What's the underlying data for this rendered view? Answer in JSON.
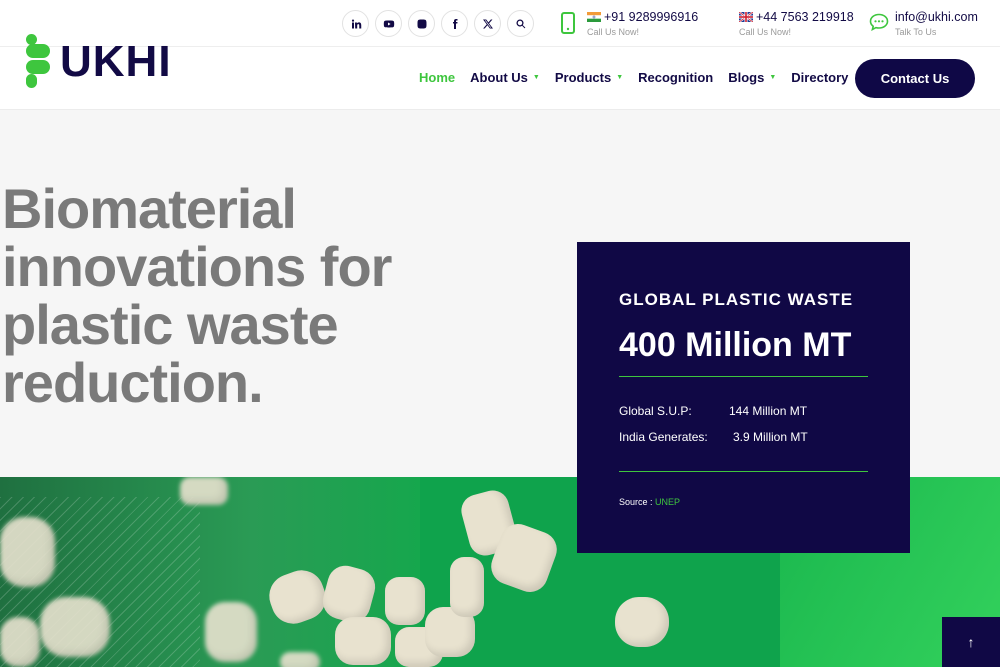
{
  "brand": {
    "name": "UKHI"
  },
  "social_icons": [
    "linkedin-icon",
    "youtube-icon",
    "instagram-icon",
    "facebook-icon",
    "x-twitter-icon",
    "search-icon"
  ],
  "contacts": {
    "india_phone": {
      "number": "+91 9289996916",
      "sub": "Call Us Now!"
    },
    "uk_phone": {
      "number": "+44 7563 219918",
      "sub": "Call Us Now!"
    },
    "email": {
      "address": "info@ukhi.com",
      "sub": "Talk To Us"
    }
  },
  "nav": {
    "items": [
      {
        "label": "Home",
        "active": true,
        "has_dropdown": false
      },
      {
        "label": "About Us",
        "active": false,
        "has_dropdown": true
      },
      {
        "label": "Products",
        "active": false,
        "has_dropdown": true
      },
      {
        "label": "Recognition",
        "active": false,
        "has_dropdown": false
      },
      {
        "label": "Blogs",
        "active": false,
        "has_dropdown": true
      },
      {
        "label": "Directory",
        "active": false,
        "has_dropdown": false
      }
    ],
    "cta_label": "Contact Us"
  },
  "hero": {
    "title_lines": [
      "Biomaterial",
      "innovations for",
      "plastic waste",
      "reduction."
    ]
  },
  "stats": {
    "label": "GLOBAL PLASTIC WASTE",
    "value": "400 Million MT",
    "rows": [
      {
        "key": "Global S.U.P:",
        "value": "144 Million MT"
      },
      {
        "key": "India Generates:",
        "value": "3.9 Million MT"
      }
    ],
    "source_prefix": "Source :",
    "source_name": "UNEP"
  },
  "scroll_top": {
    "glyph": "↑"
  },
  "colors": {
    "navy": "#100845",
    "accent_green": "#3ec63e",
    "hero_text": "#7a7a7a"
  }
}
